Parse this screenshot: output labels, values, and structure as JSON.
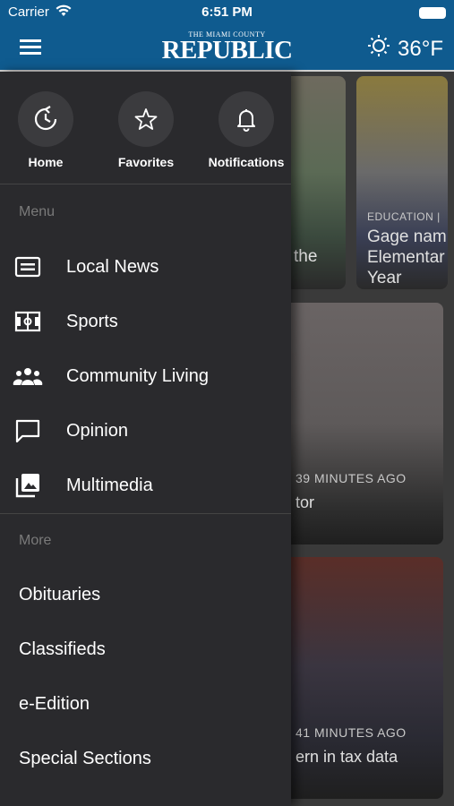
{
  "status_bar": {
    "carrier": "Carrier",
    "time": "6:51 PM"
  },
  "header": {
    "logo_small": "THE MIAMI COUNTY",
    "logo_big": "REPUBLIC",
    "temperature": "36°F",
    "weather_icon": "sun-icon",
    "menu_icon": "hamburger-menu-icon"
  },
  "background_cards": [
    {
      "label": "",
      "headline": "the"
    },
    {
      "label": "EDUCATION |",
      "headline_line1": "Gage nam",
      "headline_line2": "Elementar",
      "headline_line3": "Year"
    },
    {
      "label": "39 MINUTES AGO",
      "headline": "tor"
    },
    {
      "label": "41 MINUTES AGO",
      "headline": "ern in tax data"
    }
  ],
  "drawer": {
    "quick_links": [
      {
        "label": "Home",
        "icon": "history-refresh-icon"
      },
      {
        "label": "Favorites",
        "icon": "star-icon"
      },
      {
        "label": "Notifications",
        "icon": "bell-icon"
      }
    ],
    "menu_section": "Menu",
    "menu_items": [
      {
        "label": "Local News",
        "icon": "newspaper-icon"
      },
      {
        "label": "Sports",
        "icon": "soccer-field-icon"
      },
      {
        "label": "Community Living",
        "icon": "people-group-icon"
      },
      {
        "label": "Opinion",
        "icon": "speech-bubble-icon"
      },
      {
        "label": "Multimedia",
        "icon": "photo-library-icon"
      }
    ],
    "more_section": "More",
    "more_items": [
      {
        "label": "Obituaries"
      },
      {
        "label": "Classifieds"
      },
      {
        "label": "e-Edition"
      },
      {
        "label": "Special Sections"
      }
    ]
  }
}
